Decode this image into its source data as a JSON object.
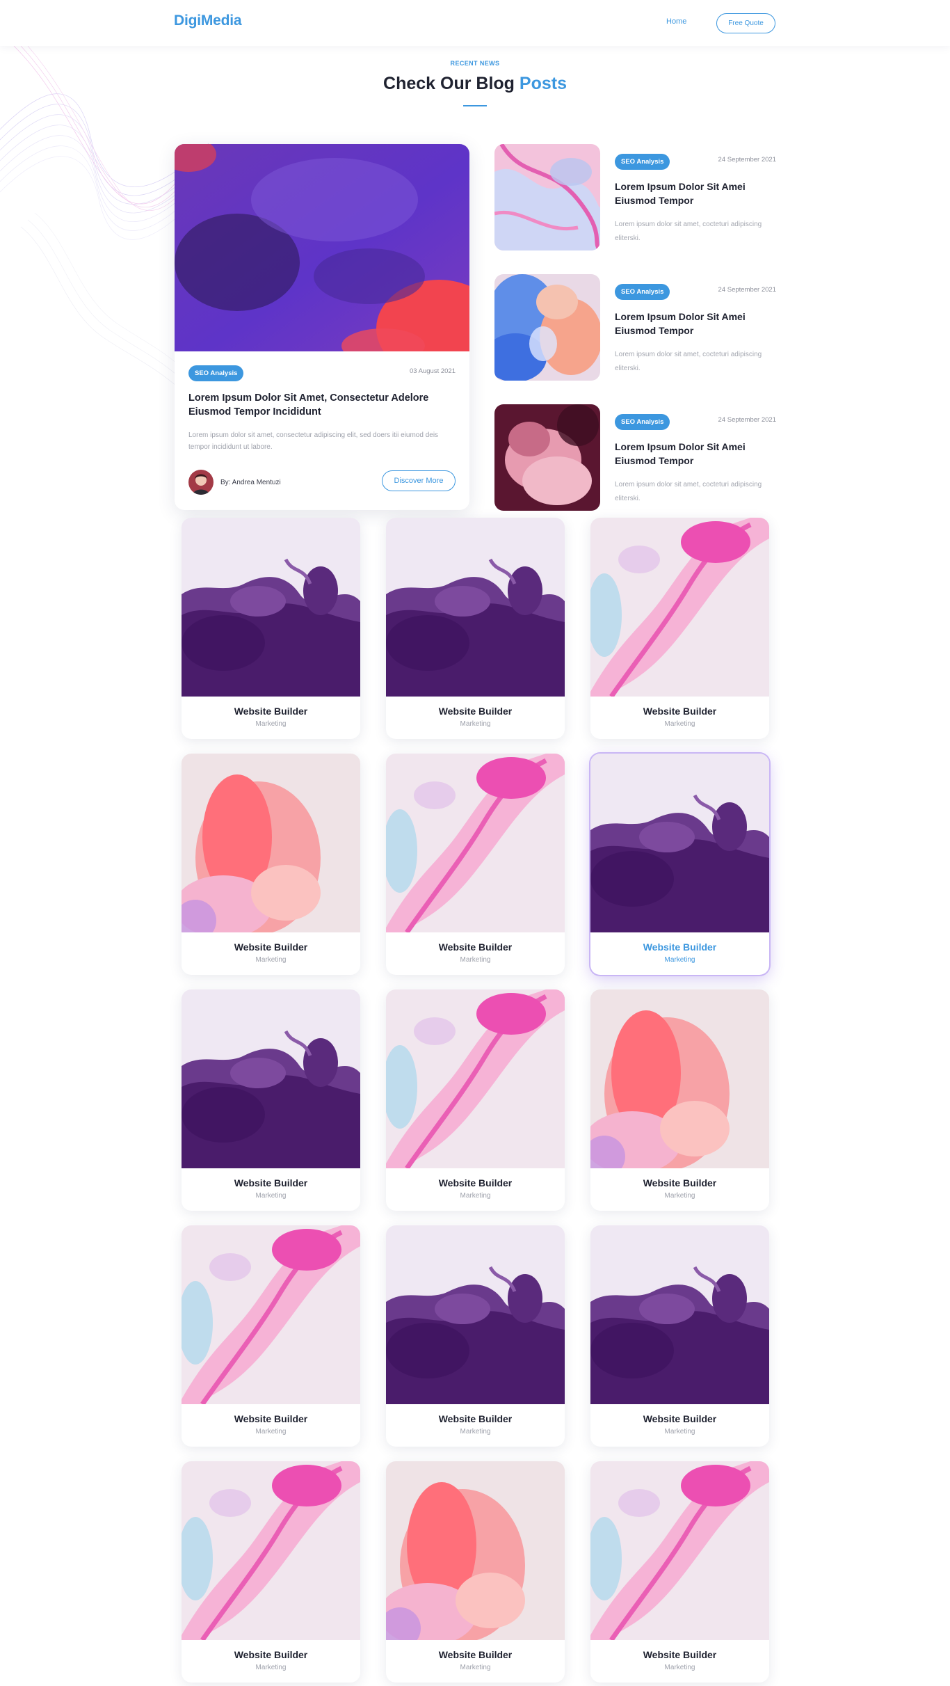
{
  "header": {
    "logo": "DigiMedia",
    "nav": {
      "home": "Home"
    },
    "cta": "Free Quote"
  },
  "section": {
    "eyebrow": "RECENT NEWS",
    "title_main": "Check Our Blog ",
    "title_accent": "Posts"
  },
  "featured": {
    "tag": "SEO Analysis",
    "date": "03 August 2021",
    "title": "Lorem Ipsum Dolor Sit Amet, Consectetur Adelore Eiusmod Tempor Incididunt",
    "excerpt": "Lorem ipsum dolor sit amet, consectetur adipiscing elit, sed doers itii eiumod deis tempor incididunt ut labore.",
    "author": "By: Andrea Mentuzi",
    "button": "Discover More"
  },
  "side_posts": [
    {
      "tag": "SEO Analysis",
      "date": "24 September 2021",
      "title": "Lorem Ipsum Dolor Sit Amei Eiusmod Tempor",
      "excerpt": "Lorem ipsum dolor sit amet, cocteturi adipiscing eliterski.",
      "image": "pink-marble"
    },
    {
      "tag": "SEO Analysis",
      "date": "24 September 2021",
      "title": "Lorem Ipsum Dolor Sit Amei Eiusmod Tempor",
      "excerpt": "Lorem ipsum dolor sit amet, cocteturi adipiscing eliterski.",
      "image": "blue-orange-smoke"
    },
    {
      "tag": "SEO Analysis",
      "date": "24 September 2021",
      "title": "Lorem Ipsum Dolor Sit Amei Eiusmod Tempor",
      "excerpt": "Lorem ipsum dolor sit amet, cocteturi adipiscing eliterski.",
      "image": "crimson-smoke"
    }
  ],
  "portfolio": [
    {
      "name": "Website Builder",
      "category": "Marketing",
      "image": "purple-ink"
    },
    {
      "name": "Website Builder",
      "category": "Marketing",
      "image": "purple-ink"
    },
    {
      "name": "Website Builder",
      "category": "Marketing",
      "image": "pink-splash"
    },
    {
      "name": "Website Builder",
      "category": "Marketing",
      "image": "coral-smoke"
    },
    {
      "name": "Website Builder",
      "category": "Marketing",
      "image": "pink-splash"
    },
    {
      "name": "Website Builder",
      "category": "Marketing",
      "image": "purple-ink",
      "active": true
    },
    {
      "name": "Website Builder",
      "category": "Marketing",
      "image": "purple-ink"
    },
    {
      "name": "Website Builder",
      "category": "Marketing",
      "image": "pink-splash"
    },
    {
      "name": "Website Builder",
      "category": "Marketing",
      "image": "coral-smoke"
    },
    {
      "name": "Website Builder",
      "category": "Marketing",
      "image": "pink-splash"
    },
    {
      "name": "Website Builder",
      "category": "Marketing",
      "image": "purple-ink"
    },
    {
      "name": "Website Builder",
      "category": "Marketing",
      "image": "purple-ink"
    },
    {
      "name": "Website Builder",
      "category": "Marketing",
      "image": "pink-splash"
    },
    {
      "name": "Website Builder",
      "category": "Marketing",
      "image": "coral-smoke"
    },
    {
      "name": "Website Builder",
      "category": "Marketing",
      "image": "pink-splash"
    }
  ],
  "colors": {
    "accent": "#3c97df",
    "text": "#1f2230",
    "muted": "#9ea1ab"
  }
}
